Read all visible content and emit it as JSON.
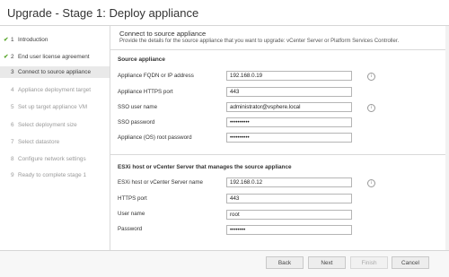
{
  "window": {
    "title": "Upgrade - Stage 1: Deploy appliance"
  },
  "steps": [
    {
      "num": "1",
      "label": "Introduction",
      "state": "done"
    },
    {
      "num": "2",
      "label": "End user license agreement",
      "state": "done"
    },
    {
      "num": "3",
      "label": "Connect to source appliance",
      "state": "active"
    },
    {
      "num": "4",
      "label": "Appliance deployment target",
      "state": "pending"
    },
    {
      "num": "5",
      "label": "Set up target appliance VM",
      "state": "pending"
    },
    {
      "num": "6",
      "label": "Select deployment size",
      "state": "pending"
    },
    {
      "num": "7",
      "label": "Select datastore",
      "state": "pending"
    },
    {
      "num": "8",
      "label": "Configure network settings",
      "state": "pending"
    },
    {
      "num": "9",
      "label": "Ready to complete stage 1",
      "state": "pending"
    }
  ],
  "page": {
    "heading": "Connect to source appliance",
    "description": "Provide the details for the source appliance that you want to upgrade: vCenter Server or Platform Services Controller."
  },
  "source": {
    "section_title": "Source appliance",
    "fqdn_label": "Appliance FQDN or IP address",
    "fqdn_value": "192.168.0.19",
    "https_port_label": "Appliance HTTPS port",
    "https_port_value": "443",
    "sso_user_label": "SSO user name",
    "sso_user_value": "administrator@vsphere.local",
    "sso_password_label": "SSO password",
    "sso_password_value": "••••••••••",
    "root_password_label": "Appliance (OS) root password",
    "root_password_value": "••••••••••"
  },
  "esxi": {
    "section_title": "ESXi host or vCenter Server that manages the source appliance",
    "host_label": "ESXi host or vCenter Server name",
    "host_value": "192.168.0.12",
    "https_port_label": "HTTPS port",
    "https_port_value": "443",
    "user_label": "User name",
    "user_value": "root",
    "password_label": "Password",
    "password_value": "••••••••"
  },
  "footer": {
    "back": "Back",
    "next": "Next",
    "finish": "Finish",
    "cancel": "Cancel"
  },
  "icons": {
    "info": "info-icon",
    "done": "checkmark-icon"
  },
  "colors": {
    "check": "#5aa72c",
    "active_step_bg": "#e9e9e9"
  }
}
